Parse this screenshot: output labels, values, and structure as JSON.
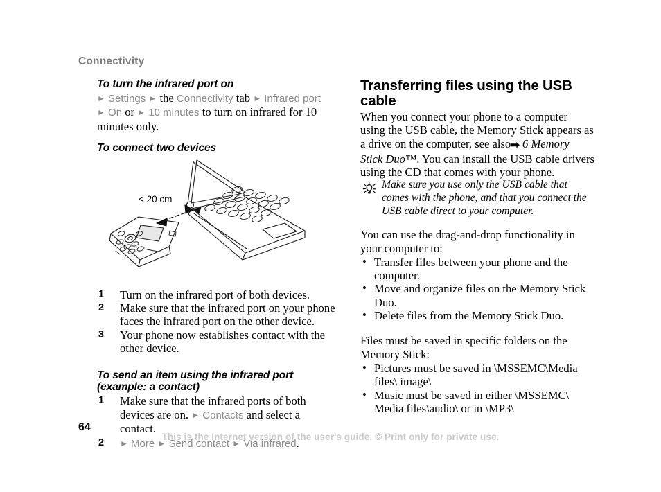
{
  "header": {
    "chapter": "Connectivity"
  },
  "left_column": {
    "task1": {
      "heading": "To turn the infrared port on",
      "line1": [
        {
          "t": "arrow"
        },
        {
          "t": "menu",
          "v": "Settings"
        },
        {
          "t": "arrow"
        },
        {
          "t": "conn",
          "v": "the"
        },
        {
          "t": "menu",
          "v": "Connectivity"
        },
        {
          "t": "conn",
          "v": "tab"
        },
        {
          "t": "arrow"
        },
        {
          "t": "menu",
          "v": "Infrared port"
        }
      ],
      "line2": [
        {
          "t": "arrow"
        },
        {
          "t": "menu",
          "v": "On"
        },
        {
          "t": "conn",
          "v": "or"
        },
        {
          "t": "arrow"
        },
        {
          "t": "menu",
          "v": "10 minutes"
        },
        {
          "t": "conn",
          "v": "to turn on infrared for 10 minutes only."
        }
      ]
    },
    "task2": {
      "heading": "To connect two devices",
      "figure": {
        "distance_label": "< 20 cm",
        "alt": "A mobile phone facing a laptop with a double-headed arrow showing the maximum infrared distance"
      },
      "steps": [
        "Turn on the infrared port of both devices.",
        "Make sure that the infrared port on your phone faces the infrared port on the other device.",
        "Your phone now establishes contact with the other device."
      ]
    },
    "task3": {
      "heading": "To send an item using the infrared port (example: a contact)",
      "step1": [
        {
          "t": "conn",
          "v": "Make sure that the infrared ports of both devices are on."
        },
        {
          "t": "arrow"
        },
        {
          "t": "menu",
          "v": "Contacts"
        },
        {
          "t": "conn",
          "v": "and select a contact."
        }
      ],
      "step2": [
        {
          "t": "arrow"
        },
        {
          "t": "menu",
          "v": "More"
        },
        {
          "t": "arrow"
        },
        {
          "t": "menu",
          "v": "Send contact"
        },
        {
          "t": "arrow"
        },
        {
          "t": "menu",
          "v": "Via infrared"
        },
        {
          "t": "conn",
          "v": "."
        }
      ]
    }
  },
  "right_column": {
    "heading": "Transferring files using the USB cable",
    "intro_part1": "When you connect your phone to a computer using the USB cable, the Memory Stick appears as a drive on the computer, see also",
    "intro_xref": "6 Memory Stick Duo™",
    "intro_part2": ". You can install the USB cable drivers using the CD that comes with your phone.",
    "tip": "Make sure you use only the USB cable that comes with the phone, and that you connect the USB cable direct to your computer.",
    "drag_intro": "You can use the drag-and-drop functionality in your computer to:",
    "drag_bullets": [
      "Transfer files between your phone and the computer.",
      "Move and organize files on the Memory Stick Duo.",
      "Delete files from the Memory Stick Duo."
    ],
    "folders_intro": "Files must be saved in specific folders on the Memory Stick:",
    "folders_bullets": [
      "Pictures must be saved in \\MSSEMC\\Media files\\ image\\",
      "Music must be saved in either \\MSSEMC\\ Media files\\audio\\ or in \\MP3\\"
    ]
  },
  "footer": {
    "page_number": "64",
    "note": "This is the Internet version of the user's guide. © Print only for private use."
  },
  "glyphs": {
    "menu_arrow": "►",
    "xref_arrow": "➡",
    "bullet": "•"
  }
}
